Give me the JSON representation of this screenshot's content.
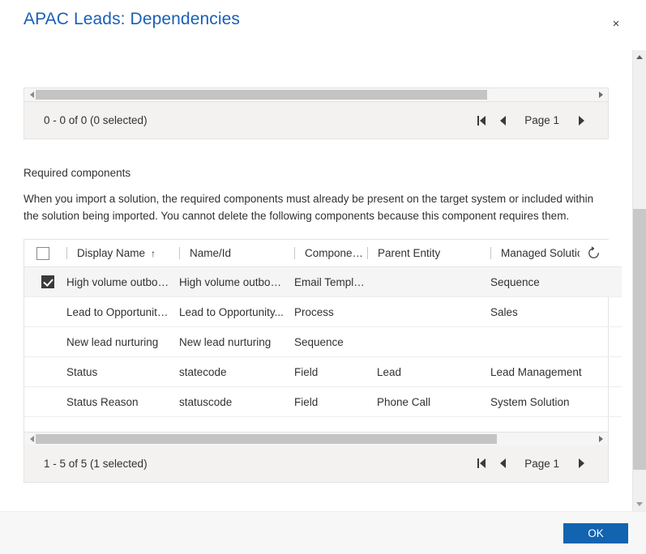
{
  "dialog": {
    "title": "APAC Leads: Dependencies",
    "close_label": "×",
    "close_icon": "close-icon"
  },
  "top_grid": {
    "h_scroll": {
      "left_icon": "chevron-left-icon",
      "right_icon": "chevron-right-icon"
    },
    "pager": {
      "count_text": "0 - 0 of 0 (0 selected)",
      "first_icon": "first-page-icon",
      "prev_icon": "previous-page-icon",
      "page_label": "Page 1",
      "next_icon": "next-page-icon"
    }
  },
  "required_components": {
    "heading": "Required components",
    "description": "When you import a solution, the required components must already be present on the target system or included within the solution being imported. You cannot delete the following components because this component requires them.",
    "grid": {
      "select_all_checked": false,
      "refresh_icon": "refresh-spinner-icon",
      "columns": [
        {
          "label": "Display Name",
          "sort": "↑"
        },
        {
          "label": "Name/Id",
          "sort": ""
        },
        {
          "label": "Component T...",
          "sort": ""
        },
        {
          "label": "Parent Entity",
          "sort": ""
        },
        {
          "label": "Managed Solution",
          "sort": ""
        }
      ],
      "rows": [
        {
          "selected": true,
          "display_name": "High volume outbou...",
          "name_id": "High volume outbou...",
          "component_type": "Email Template",
          "parent_entity": "",
          "managed_solution": "Sequence"
        },
        {
          "selected": false,
          "display_name": "Lead to Opportunity...",
          "name_id": "Lead to Opportunity...",
          "component_type": "Process",
          "parent_entity": "",
          "managed_solution": "Sales"
        },
        {
          "selected": false,
          "display_name": "New lead nurturing",
          "name_id": "New lead nurturing",
          "component_type": "Sequence",
          "parent_entity": "",
          "managed_solution": ""
        },
        {
          "selected": false,
          "display_name": "Status",
          "name_id": "statecode",
          "component_type": "Field",
          "parent_entity": "Lead",
          "managed_solution": "Lead Management"
        },
        {
          "selected": false,
          "display_name": "Status Reason",
          "name_id": "statuscode",
          "component_type": "Field",
          "parent_entity": "Phone Call",
          "managed_solution": "System Solution"
        }
      ]
    },
    "h_scroll": {
      "left_icon": "chevron-left-icon",
      "right_icon": "chevron-right-icon"
    },
    "pager": {
      "count_text": "1 - 5 of 5 (1 selected)",
      "first_icon": "first-page-icon",
      "prev_icon": "previous-page-icon",
      "page_label": "Page 1",
      "next_icon": "next-page-icon"
    }
  },
  "footer": {
    "ok_label": "OK"
  },
  "colors": {
    "title": "#1b5fb5",
    "primary_button": "#1263b0",
    "text": "#323130",
    "pager_bg": "#f3f2f1",
    "scroll_thumb": "#c4c4c4"
  }
}
